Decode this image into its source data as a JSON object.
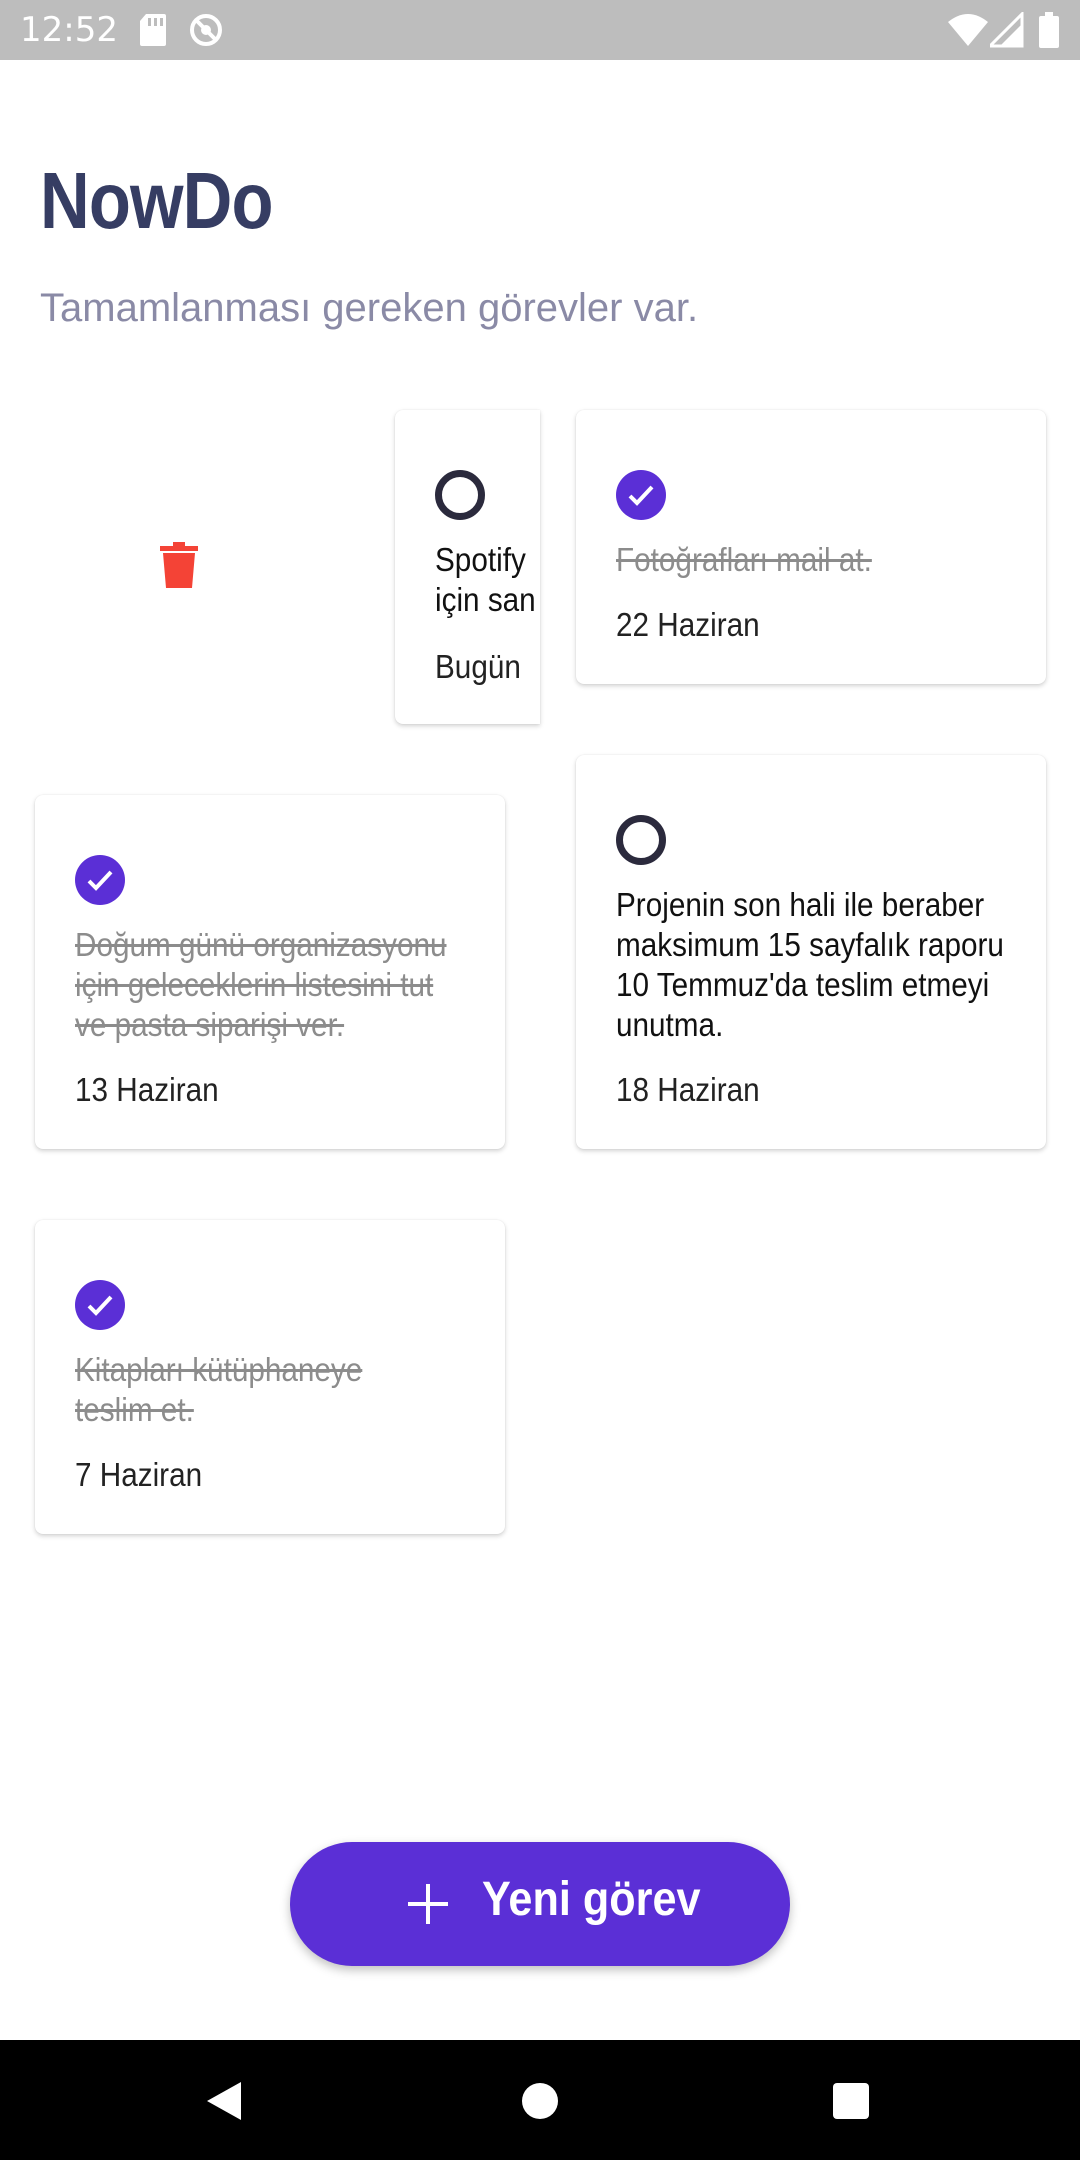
{
  "status_bar": {
    "time": "12:52",
    "icons": [
      "sd-card-icon",
      "sync-icon",
      "wifi-icon",
      "signal-icon",
      "battery-icon"
    ],
    "background": "#bdbdbd"
  },
  "header": {
    "title": "NowDo",
    "subtitle": "Tamamlanması gereken görevler var."
  },
  "tasks": [
    {
      "text": "Spotify\niçin san",
      "date": "Bugün",
      "done": false,
      "swiped_to_delete": true
    },
    {
      "text": "Fotoğrafları mail at.",
      "date": "22 Haziran",
      "done": true
    },
    {
      "text": "Doğum günü organizasyonu için geleceklerin listesini tut ve pasta siparişi ver.",
      "date": "13 Haziran",
      "done": true
    },
    {
      "text": "Projenin son hali ile beraber maksimum 15 sayfalık raporu 10 Temmuz'da teslim etmeyi unutma.",
      "date": "18 Haziran",
      "done": false
    },
    {
      "text": "Kitapları kütüphaneye teslim et.",
      "date": "7 Haziran",
      "done": true
    }
  ],
  "fab": {
    "label": "Yeni görev",
    "icon": "plus-icon"
  },
  "nav": {
    "icons": [
      "back-icon",
      "home-icon",
      "recents-icon"
    ]
  },
  "colors": {
    "accent": "#5b2fd6",
    "title": "#363d63",
    "subtitle": "#8a8aa6",
    "delete": "#f44336"
  }
}
